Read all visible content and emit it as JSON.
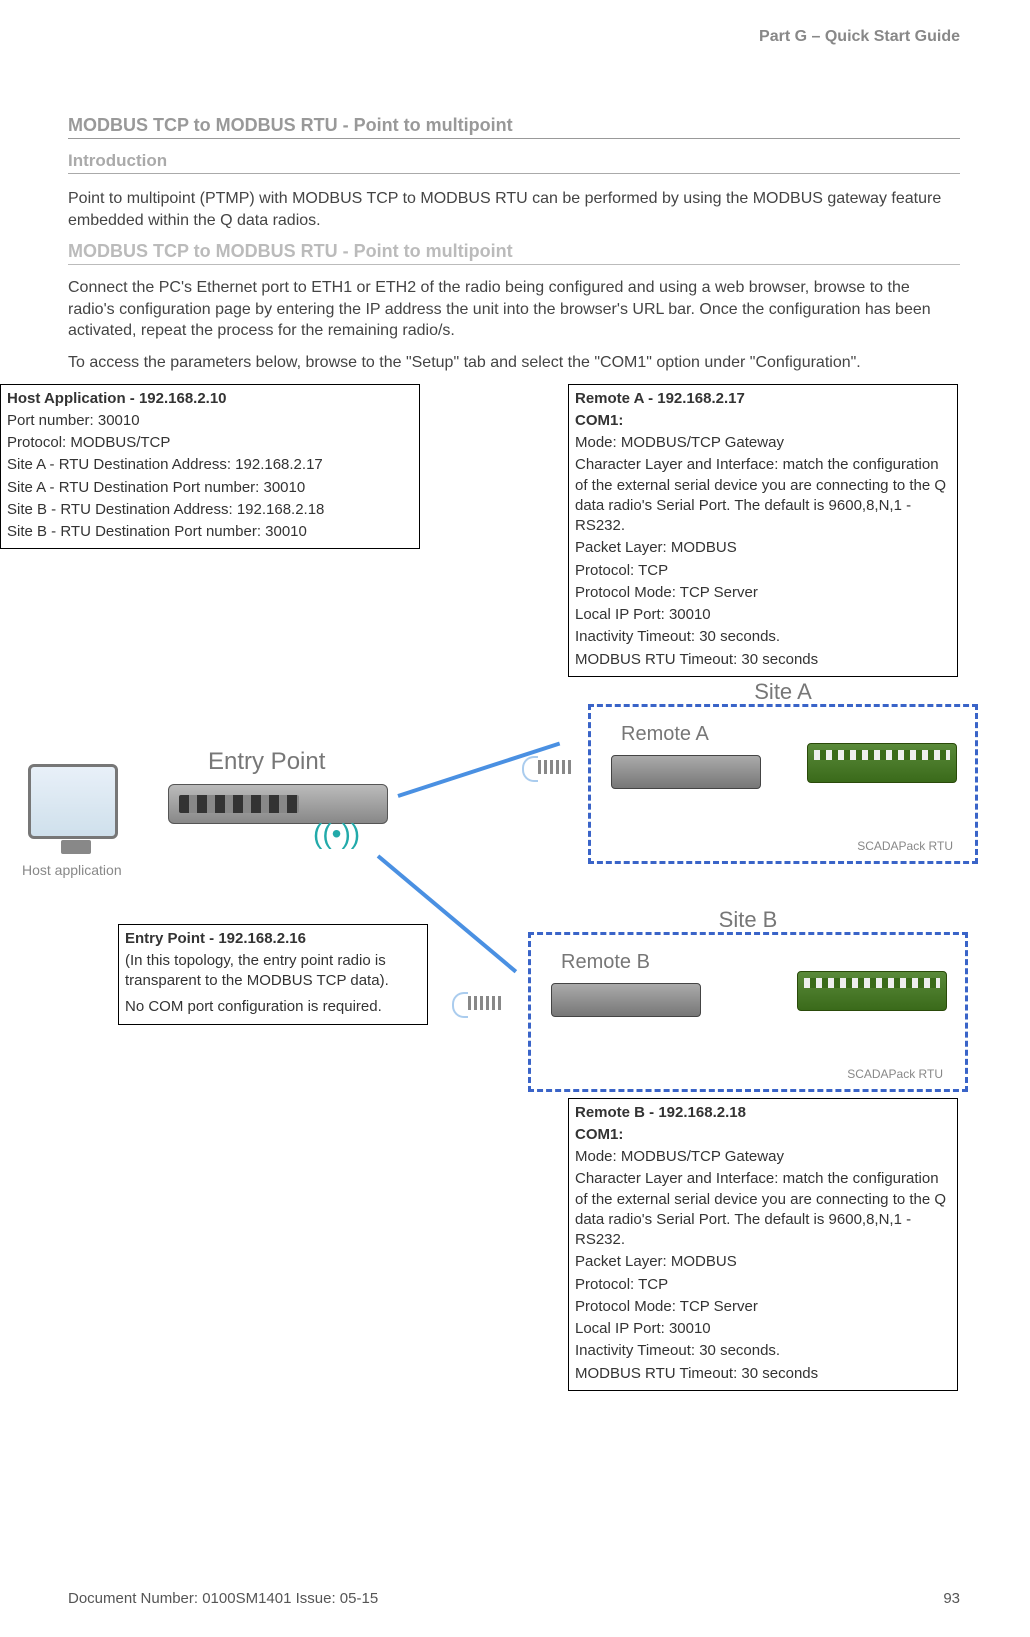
{
  "header": {
    "part": "Part G – Quick Start Guide"
  },
  "titles": {
    "main": "MODBUS TCP to MODBUS RTU - Point to multipoint",
    "intro": "Introduction",
    "main2": "MODBUS TCP to MODBUS RTU - Point to multipoint"
  },
  "paras": {
    "p1": "Point to multipoint (PTMP) with MODBUS TCP to MODBUS RTU can be performed by using the MODBUS gateway feature embedded within the Q data radios.",
    "p2": "Connect the PC's Ethernet port to ETH1 or ETH2 of the radio being configured and using a web browser, browse to the radio's configuration page by entering the IP address the unit into the browser's URL bar.  Once the configuration has been activated, repeat the process for the remaining radio/s.",
    "p3": "To access the parameters below, browse to the \"Setup\" tab and select the \"COM1\" option under \"Configuration\"."
  },
  "diagram": {
    "hostLabel": "Host application",
    "entryLabel": "Entry Point",
    "siteA": "Site A",
    "siteB": "Site B",
    "remoteA": "Remote A",
    "remoteB": "Remote B",
    "rtu": "SCADAPack RTU"
  },
  "boxes": {
    "host": {
      "title": "Host Application - 192.168.2.10",
      "l1": "Port number: 30010",
      "l2": "Protocol: MODBUS/TCP",
      "l3": "Site A - RTU Destination Address: 192.168.2.17",
      "l4": "Site A - RTU Destination Port number: 30010",
      "l5": "Site B - RTU Destination Address: 192.168.2.18",
      "l6": "Site B - RTU Destination Port number: 30010"
    },
    "entry": {
      "title": "Entry Point - 192.168.2.16",
      "l1": "(In this topology, the entry point radio is transparent to the MODBUS TCP data).",
      "l2": "No COM port configuration is required."
    },
    "remoteA": {
      "title": "Remote A - 192.168.2.17",
      "com": "COM1:",
      "l1": "Mode: MODBUS/TCP Gateway",
      "l2": "Character Layer and Interface: match the configuration of the external serial device you are connecting to the Q data radio's Serial Port. The default is 9600,8,N,1 - RS232.",
      "l3": "Packet Layer: MODBUS",
      "l4": "Protocol: TCP",
      "l5": "Protocol Mode: TCP Server",
      "l6": "Local IP Port: 30010",
      "l7": "Inactivity Timeout: 30 seconds.",
      "l8": "MODBUS RTU Timeout: 30 seconds"
    },
    "remoteB": {
      "title": "Remote B - 192.168.2.18",
      "com": "COM1:",
      "l1": "Mode: MODBUS/TCP Gateway",
      "l2": "Character Layer and Interface: match the configuration of the external serial device you are connecting to the Q data radio's Serial Port. The default is 9600,8,N,1 - RS232.",
      "l3": "Packet Layer: MODBUS",
      "l4": "Protocol: TCP",
      "l5": "Protocol Mode: TCP Server",
      "l6": "Local IP Port: 30010",
      "l7": "Inactivity Timeout: 30 seconds.",
      "l8": "MODBUS RTU Timeout: 30 seconds"
    }
  },
  "footer": {
    "doc": "Document Number: 0100SM1401   Issue: 05-15",
    "page": "93"
  }
}
